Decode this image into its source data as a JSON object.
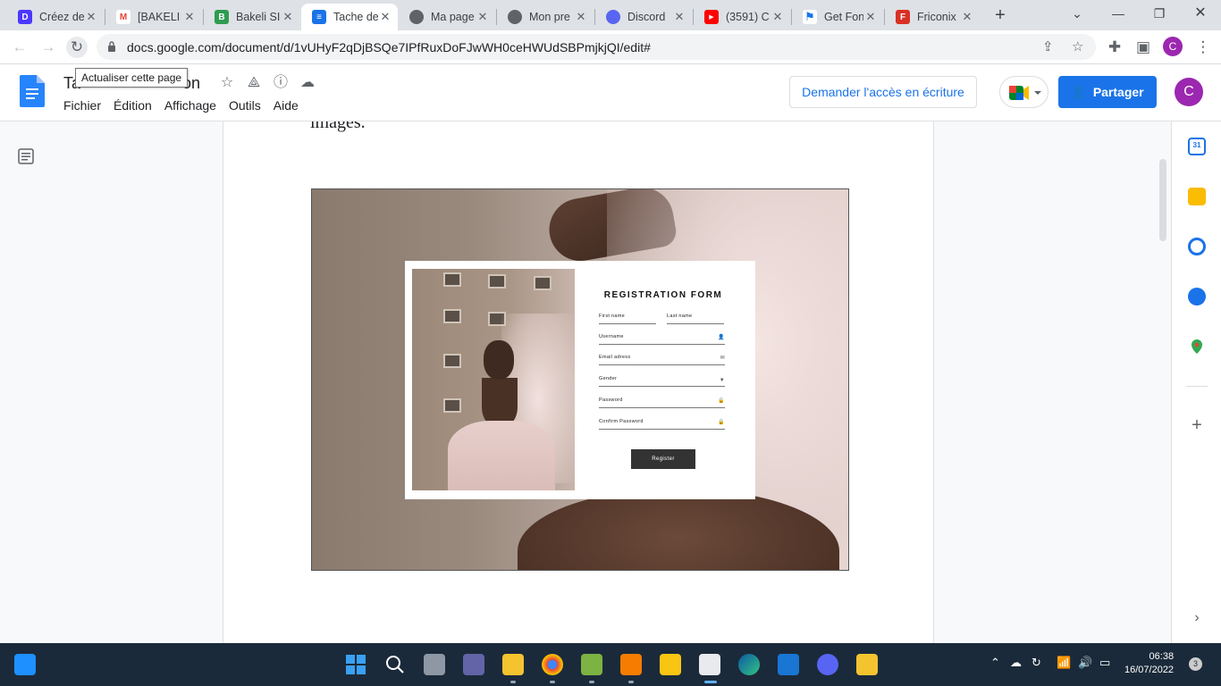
{
  "browser": {
    "tabs": [
      {
        "title": "Créez de",
        "icon": "canva-icon",
        "color": "#4b38ff"
      },
      {
        "title": "[BAKELI",
        "icon": "gmail-icon",
        "color": "#ea4335"
      },
      {
        "title": "Bakeli SI",
        "icon": "bakeli-icon",
        "color": "#2e9c50"
      },
      {
        "title": "Tache de",
        "icon": "docs-icon",
        "color": "#1a73e8"
      },
      {
        "title": "Ma page",
        "icon": "globe-icon",
        "color": "#5f6368"
      },
      {
        "title": "Mon pre",
        "icon": "globe-icon",
        "color": "#5f6368"
      },
      {
        "title": "Discord",
        "icon": "discord-icon",
        "color": "#5865f2"
      },
      {
        "title": "(3591) C",
        "icon": "youtube-icon",
        "color": "#ff0000"
      },
      {
        "title": "Get Fon",
        "icon": "flag-icon",
        "color": "#1a73e8"
      },
      {
        "title": "Friconix",
        "icon": "friconix-icon",
        "color": "#d93025"
      }
    ],
    "active_tab_index": 3,
    "url": "docs.google.com/document/d/1vUHyF2qDjBSQe7IPfRuxDoFJwWH0ceHWUdSBPmjkjQI/edit#",
    "profile_initial": "C"
  },
  "docs": {
    "title_visible_start": "Ta",
    "title_visible_end": "on",
    "tooltip": "Actualiser cette page",
    "menu": [
      "Fichier",
      "Édition",
      "Affichage",
      "Outils",
      "Aide"
    ],
    "request_access": "Demander l'accès en écriture",
    "share": "Partager",
    "profile_initial": "C",
    "body_text": "images."
  },
  "form_image": {
    "title": "REGISTRATION FORM",
    "fields": {
      "first_name": "First name",
      "last_name": "Last name",
      "username": "Username",
      "email": "Email adress",
      "gender": "Gender",
      "password": "Password",
      "confirm_password": "Confirm Password"
    },
    "button": "Register"
  },
  "side_panel": {
    "calendar_day": "31",
    "icons": [
      "calendar-icon",
      "keep-icon",
      "tasks-icon",
      "contacts-icon",
      "maps-icon",
      "add-icon"
    ]
  },
  "taskbar": {
    "time": "06:38",
    "date": "16/07/2022",
    "notification_count": "3"
  }
}
